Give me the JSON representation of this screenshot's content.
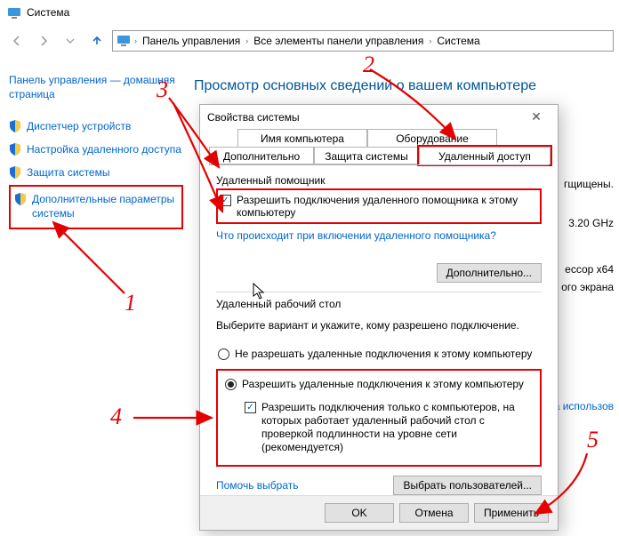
{
  "titlebar": {
    "title": "Система"
  },
  "navbar": {
    "crumbs": [
      "Панель управления",
      "Все элементы панели управления",
      "Система"
    ]
  },
  "sidebar": {
    "home": "Панель управления — домашняя страница",
    "items": [
      {
        "label": "Диспетчер устройств"
      },
      {
        "label": "Настройка удаленного доступа"
      },
      {
        "label": "Защита системы"
      },
      {
        "label": "Дополнительные параметры системы"
      }
    ]
  },
  "main": {
    "heading": "Просмотр основных сведений о вашем компьютере"
  },
  "bg": {
    "protected": "гщищены.",
    "ghz": "3.20 GHz",
    "arch": "ессор x64",
    "screen": "ого экрана",
    "usage": "я на использов"
  },
  "dialog": {
    "title": "Свойства системы",
    "tabs": {
      "computer_name": "Имя компьютера",
      "hardware": "Оборудование",
      "advanced": "Дополнительно",
      "protection": "Защита системы",
      "remote": "Удаленный доступ"
    },
    "assist": {
      "group": "Удаленный помощник",
      "checkbox": "Разрешить подключения удаленного помощника к этому компьютеру",
      "link": "Что происходит при включении удаленного помощника?",
      "btn": "Дополнительно..."
    },
    "rdp": {
      "group": "Удаленный рабочий стол",
      "desc": "Выберите вариант и укажите, кому разрешено подключение.",
      "radio_off": "Не разрешать удаленные подключения к этому компьютеру",
      "radio_on": "Разрешить удаленные подключения к этому компьютеру",
      "nla": "Разрешить подключения только с компьютеров, на которых работает удаленный рабочий стол с проверкой подлинности на уровне сети (рекомендуется)",
      "help": "Помочь выбрать",
      "users": "Выбрать пользователей..."
    },
    "footer": {
      "ok": "OK",
      "cancel": "Отмена",
      "apply": "Применить"
    }
  },
  "anno": {
    "n1": "1",
    "n2": "2",
    "n3": "3",
    "n4": "4",
    "n5": "5"
  }
}
